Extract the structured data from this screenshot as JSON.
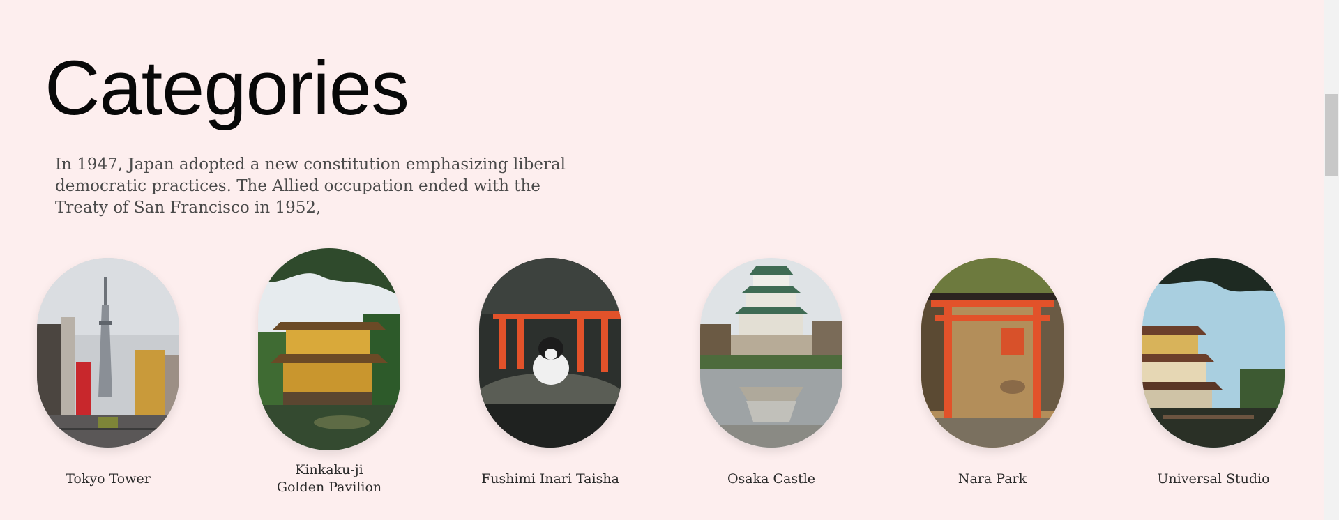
{
  "section": {
    "title": "Categories",
    "intro": "In 1947, Japan adopted a new constitution emphasizing liberal democratic practices. The Allied occupation ended with the Treaty of San Francisco in 1952,"
  },
  "categories": [
    {
      "label_lines": [
        "Tokyo Tower"
      ]
    },
    {
      "label_lines": [
        "Kinkaku-ji",
        "Golden Pavilion"
      ]
    },
    {
      "label_lines": [
        "Fushimi Inari Taisha"
      ]
    },
    {
      "label_lines": [
        "Osaka Castle"
      ]
    },
    {
      "label_lines": [
        "Nara Park"
      ]
    },
    {
      "label_lines": [
        "Universal Studio"
      ]
    }
  ],
  "colors": {
    "background": "#fdeeee",
    "title": "#080808",
    "intro_text": "#4a4a4a",
    "torii_orange": "#e2522a"
  }
}
